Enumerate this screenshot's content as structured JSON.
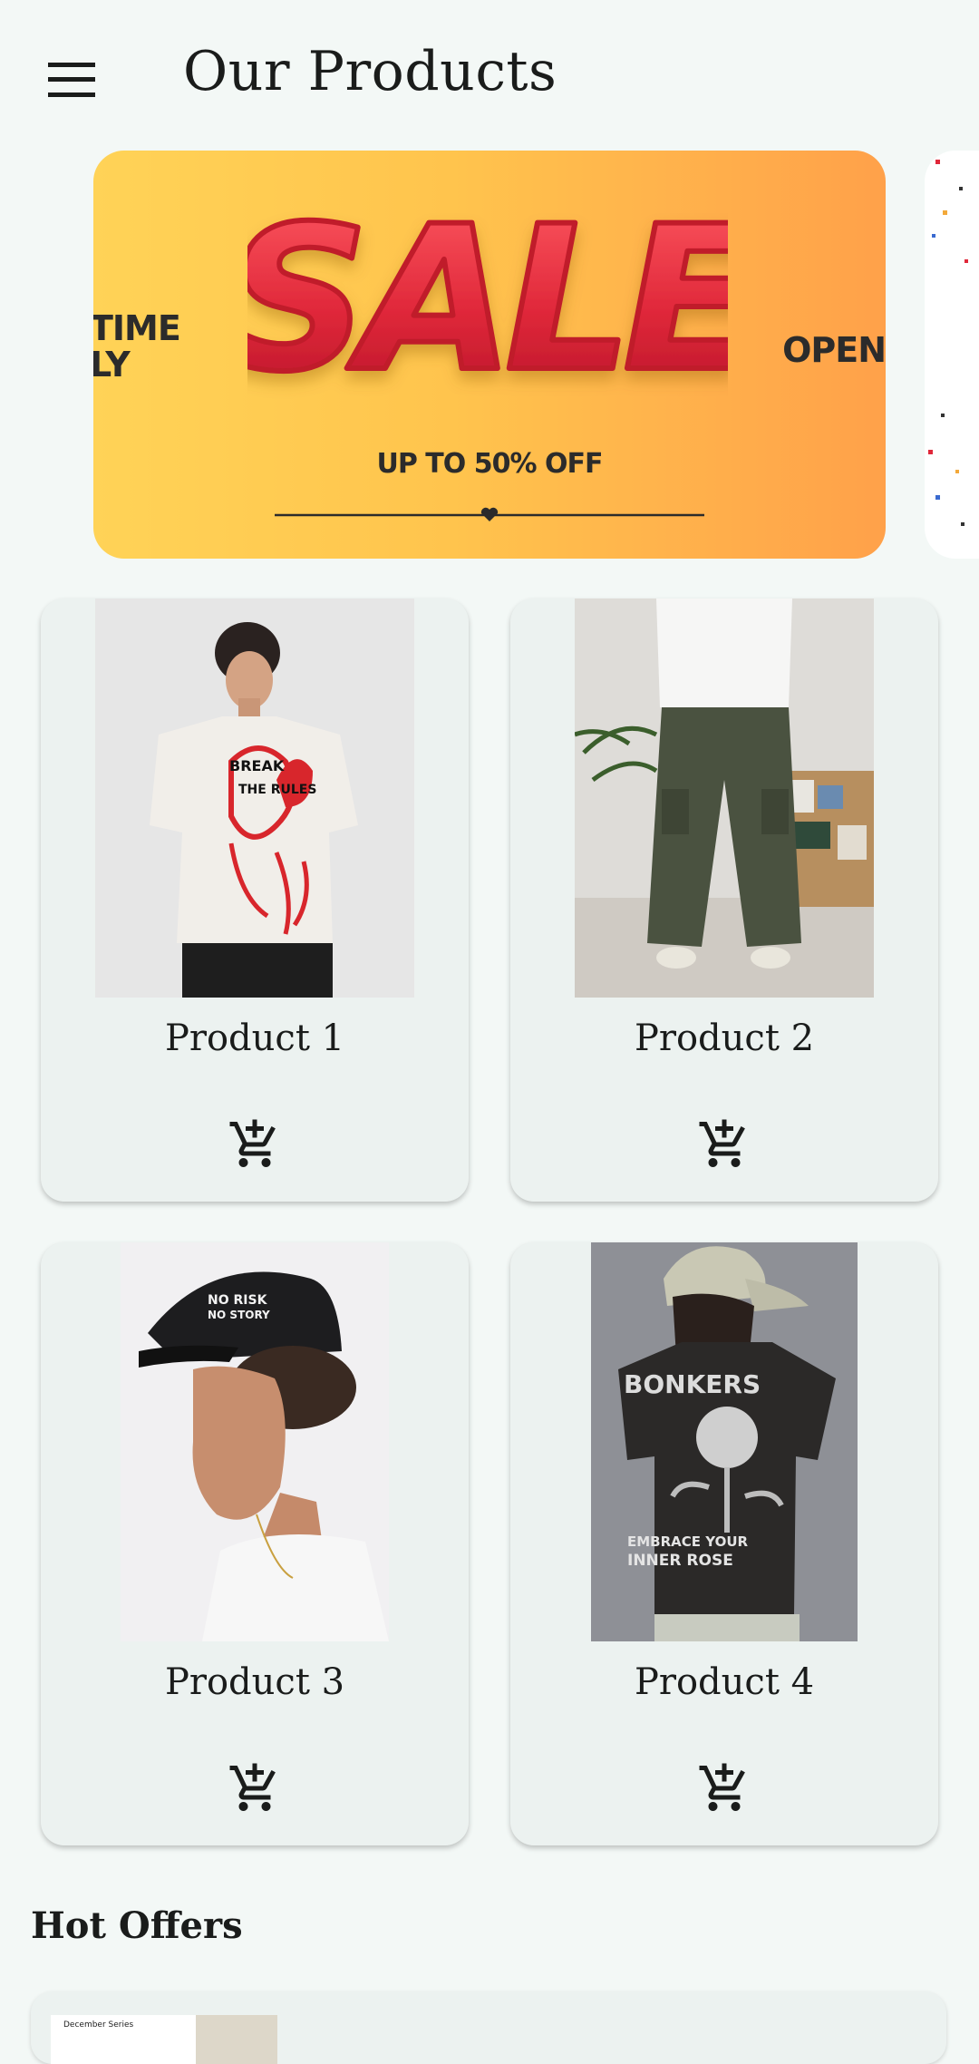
{
  "header": {
    "title": "Our Products",
    "menu_icon": "hamburger-menu-icon"
  },
  "banner": {
    "headline": "SALE",
    "subtitle": "UP TO 50% OFF",
    "left_text_line1": "TIME",
    "left_text_line2": "LY",
    "right_text": "OPEN",
    "colors": {
      "start": "#ffd357",
      "end": "#ffa14a",
      "headline": "#e0283a"
    }
  },
  "products": [
    {
      "name": "Product 1",
      "cart_icon": "add-shopping-cart-icon"
    },
    {
      "name": "Product 2",
      "cart_icon": "add-shopping-cart-icon"
    },
    {
      "name": "Product 3",
      "cart_icon": "add-shopping-cart-icon"
    },
    {
      "name": "Product 4",
      "cart_icon": "add-shopping-cart-icon"
    }
  ],
  "offers": {
    "title": "Hot Offers",
    "items": [
      {
        "thumb_text": "December Series"
      }
    ]
  }
}
